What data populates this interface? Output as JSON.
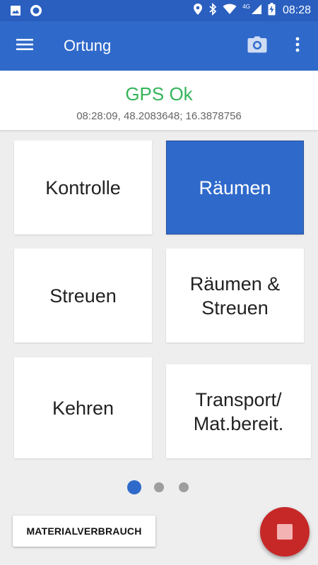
{
  "status_bar": {
    "time": "08:28",
    "network_label": "4G",
    "left_icons": [
      "image-icon",
      "circle-notification-icon"
    ],
    "right_icons": [
      "location-icon",
      "bluetooth-icon",
      "wifi-icon",
      "signal-icon",
      "battery-charging-icon"
    ]
  },
  "app_bar": {
    "title": "Ortung",
    "icons": [
      "menu-icon",
      "camera-icon",
      "more-vert-icon"
    ]
  },
  "gps": {
    "status": "GPS Ok",
    "coords": "08:28:09, 48.2083648; 16.3878756",
    "status_color": "#35b55b"
  },
  "tiles": [
    {
      "label": "Kontrolle",
      "active": false
    },
    {
      "label": "Räumen",
      "active": true
    },
    {
      "label": "Streuen",
      "active": false
    },
    {
      "label": "Räumen &\nStreuen",
      "active": false
    },
    {
      "label": "Kehren",
      "active": false
    },
    {
      "label": "Transport/\nMat.bereit.",
      "active": false
    }
  ],
  "pager": {
    "pages": 3,
    "current": 1
  },
  "bottom": {
    "material_label": "MATERIALVERBRAUCH"
  },
  "colors": {
    "primary": "#2f6acb",
    "primary_dark": "#2a5fbf",
    "fab": "#c62828",
    "dot_inactive": "#9e9e9e"
  }
}
